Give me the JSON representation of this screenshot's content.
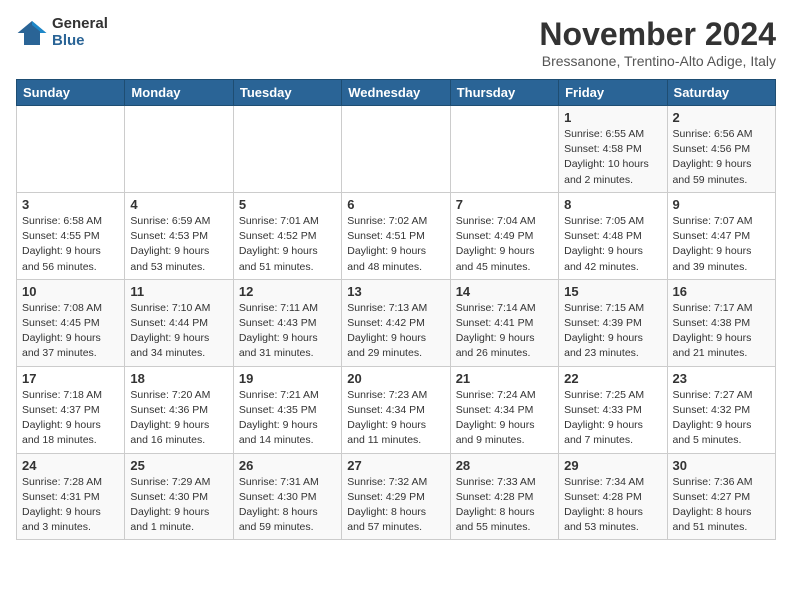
{
  "logo": {
    "general": "General",
    "blue": "Blue"
  },
  "title": "November 2024",
  "subtitle": "Bressanone, Trentino-Alto Adige, Italy",
  "days_of_week": [
    "Sunday",
    "Monday",
    "Tuesday",
    "Wednesday",
    "Thursday",
    "Friday",
    "Saturday"
  ],
  "weeks": [
    [
      {
        "day": "",
        "sunrise": "",
        "sunset": "",
        "daylight": ""
      },
      {
        "day": "",
        "sunrise": "",
        "sunset": "",
        "daylight": ""
      },
      {
        "day": "",
        "sunrise": "",
        "sunset": "",
        "daylight": ""
      },
      {
        "day": "",
        "sunrise": "",
        "sunset": "",
        "daylight": ""
      },
      {
        "day": "",
        "sunrise": "",
        "sunset": "",
        "daylight": ""
      },
      {
        "day": "1",
        "sunrise": "Sunrise: 6:55 AM",
        "sunset": "Sunset: 4:58 PM",
        "daylight": "Daylight: 10 hours and 2 minutes."
      },
      {
        "day": "2",
        "sunrise": "Sunrise: 6:56 AM",
        "sunset": "Sunset: 4:56 PM",
        "daylight": "Daylight: 9 hours and 59 minutes."
      }
    ],
    [
      {
        "day": "3",
        "sunrise": "Sunrise: 6:58 AM",
        "sunset": "Sunset: 4:55 PM",
        "daylight": "Daylight: 9 hours and 56 minutes."
      },
      {
        "day": "4",
        "sunrise": "Sunrise: 6:59 AM",
        "sunset": "Sunset: 4:53 PM",
        "daylight": "Daylight: 9 hours and 53 minutes."
      },
      {
        "day": "5",
        "sunrise": "Sunrise: 7:01 AM",
        "sunset": "Sunset: 4:52 PM",
        "daylight": "Daylight: 9 hours and 51 minutes."
      },
      {
        "day": "6",
        "sunrise": "Sunrise: 7:02 AM",
        "sunset": "Sunset: 4:51 PM",
        "daylight": "Daylight: 9 hours and 48 minutes."
      },
      {
        "day": "7",
        "sunrise": "Sunrise: 7:04 AM",
        "sunset": "Sunset: 4:49 PM",
        "daylight": "Daylight: 9 hours and 45 minutes."
      },
      {
        "day": "8",
        "sunrise": "Sunrise: 7:05 AM",
        "sunset": "Sunset: 4:48 PM",
        "daylight": "Daylight: 9 hours and 42 minutes."
      },
      {
        "day": "9",
        "sunrise": "Sunrise: 7:07 AM",
        "sunset": "Sunset: 4:47 PM",
        "daylight": "Daylight: 9 hours and 39 minutes."
      }
    ],
    [
      {
        "day": "10",
        "sunrise": "Sunrise: 7:08 AM",
        "sunset": "Sunset: 4:45 PM",
        "daylight": "Daylight: 9 hours and 37 minutes."
      },
      {
        "day": "11",
        "sunrise": "Sunrise: 7:10 AM",
        "sunset": "Sunset: 4:44 PM",
        "daylight": "Daylight: 9 hours and 34 minutes."
      },
      {
        "day": "12",
        "sunrise": "Sunrise: 7:11 AM",
        "sunset": "Sunset: 4:43 PM",
        "daylight": "Daylight: 9 hours and 31 minutes."
      },
      {
        "day": "13",
        "sunrise": "Sunrise: 7:13 AM",
        "sunset": "Sunset: 4:42 PM",
        "daylight": "Daylight: 9 hours and 29 minutes."
      },
      {
        "day": "14",
        "sunrise": "Sunrise: 7:14 AM",
        "sunset": "Sunset: 4:41 PM",
        "daylight": "Daylight: 9 hours and 26 minutes."
      },
      {
        "day": "15",
        "sunrise": "Sunrise: 7:15 AM",
        "sunset": "Sunset: 4:39 PM",
        "daylight": "Daylight: 9 hours and 23 minutes."
      },
      {
        "day": "16",
        "sunrise": "Sunrise: 7:17 AM",
        "sunset": "Sunset: 4:38 PM",
        "daylight": "Daylight: 9 hours and 21 minutes."
      }
    ],
    [
      {
        "day": "17",
        "sunrise": "Sunrise: 7:18 AM",
        "sunset": "Sunset: 4:37 PM",
        "daylight": "Daylight: 9 hours and 18 minutes."
      },
      {
        "day": "18",
        "sunrise": "Sunrise: 7:20 AM",
        "sunset": "Sunset: 4:36 PM",
        "daylight": "Daylight: 9 hours and 16 minutes."
      },
      {
        "day": "19",
        "sunrise": "Sunrise: 7:21 AM",
        "sunset": "Sunset: 4:35 PM",
        "daylight": "Daylight: 9 hours and 14 minutes."
      },
      {
        "day": "20",
        "sunrise": "Sunrise: 7:23 AM",
        "sunset": "Sunset: 4:34 PM",
        "daylight": "Daylight: 9 hours and 11 minutes."
      },
      {
        "day": "21",
        "sunrise": "Sunrise: 7:24 AM",
        "sunset": "Sunset: 4:34 PM",
        "daylight": "Daylight: 9 hours and 9 minutes."
      },
      {
        "day": "22",
        "sunrise": "Sunrise: 7:25 AM",
        "sunset": "Sunset: 4:33 PM",
        "daylight": "Daylight: 9 hours and 7 minutes."
      },
      {
        "day": "23",
        "sunrise": "Sunrise: 7:27 AM",
        "sunset": "Sunset: 4:32 PM",
        "daylight": "Daylight: 9 hours and 5 minutes."
      }
    ],
    [
      {
        "day": "24",
        "sunrise": "Sunrise: 7:28 AM",
        "sunset": "Sunset: 4:31 PM",
        "daylight": "Daylight: 9 hours and 3 minutes."
      },
      {
        "day": "25",
        "sunrise": "Sunrise: 7:29 AM",
        "sunset": "Sunset: 4:30 PM",
        "daylight": "Daylight: 9 hours and 1 minute."
      },
      {
        "day": "26",
        "sunrise": "Sunrise: 7:31 AM",
        "sunset": "Sunset: 4:30 PM",
        "daylight": "Daylight: 8 hours and 59 minutes."
      },
      {
        "day": "27",
        "sunrise": "Sunrise: 7:32 AM",
        "sunset": "Sunset: 4:29 PM",
        "daylight": "Daylight: 8 hours and 57 minutes."
      },
      {
        "day": "28",
        "sunrise": "Sunrise: 7:33 AM",
        "sunset": "Sunset: 4:28 PM",
        "daylight": "Daylight: 8 hours and 55 minutes."
      },
      {
        "day": "29",
        "sunrise": "Sunrise: 7:34 AM",
        "sunset": "Sunset: 4:28 PM",
        "daylight": "Daylight: 8 hours and 53 minutes."
      },
      {
        "day": "30",
        "sunrise": "Sunrise: 7:36 AM",
        "sunset": "Sunset: 4:27 PM",
        "daylight": "Daylight: 8 hours and 51 minutes."
      }
    ]
  ]
}
